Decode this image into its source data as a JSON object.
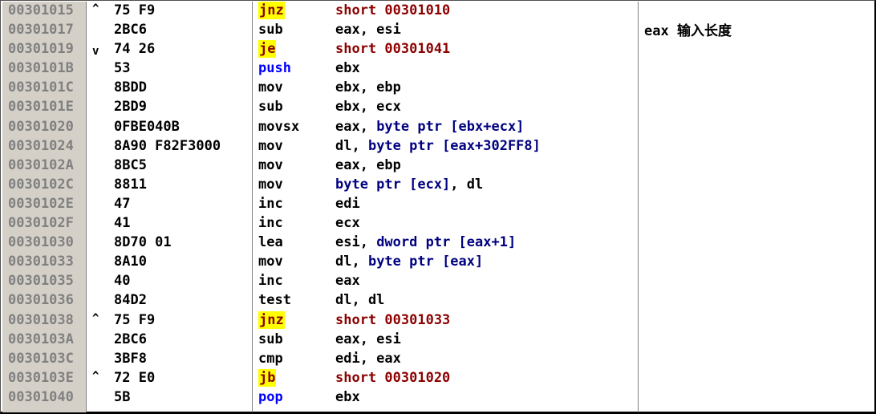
{
  "comment": "eax 输入长度",
  "rows": [
    {
      "addr": "00301015",
      "arrow": "^",
      "hex": "75 F9",
      "mnemonic": "jnz",
      "kind": "jump",
      "ops": [
        {
          "t": "short 00301010",
          "c": "jump"
        }
      ]
    },
    {
      "addr": "00301017",
      "arrow": "",
      "hex": "2BC6",
      "mnemonic": "sub",
      "kind": "plain",
      "ops": [
        {
          "t": "eax, esi",
          "c": "plain"
        }
      ]
    },
    {
      "addr": "00301019",
      "arrow": "v",
      "hex": "74 26",
      "mnemonic": "je",
      "kind": "jump",
      "ops": [
        {
          "t": "short 00301041",
          "c": "jump"
        }
      ]
    },
    {
      "addr": "0030101B",
      "arrow": "",
      "hex": "53",
      "mnemonic": "push",
      "kind": "stack",
      "ops": [
        {
          "t": "ebx",
          "c": "plain"
        }
      ]
    },
    {
      "addr": "0030101C",
      "arrow": "",
      "hex": "8BDD",
      "mnemonic": "mov",
      "kind": "plain",
      "ops": [
        {
          "t": "ebx, ebp",
          "c": "plain"
        }
      ]
    },
    {
      "addr": "0030101E",
      "arrow": "",
      "hex": "2BD9",
      "mnemonic": "sub",
      "kind": "plain",
      "ops": [
        {
          "t": "ebx, ecx",
          "c": "plain"
        }
      ]
    },
    {
      "addr": "00301020",
      "arrow": "",
      "hex": "0FBE040B",
      "mnemonic": "movsx",
      "kind": "plain",
      "ops": [
        {
          "t": "eax, ",
          "c": "plain"
        },
        {
          "t": "byte ptr [ebx+ecx]",
          "c": "size"
        }
      ]
    },
    {
      "addr": "00301024",
      "arrow": "",
      "hex": "8A90 F82F3000",
      "mnemonic": "mov",
      "kind": "plain",
      "ops": [
        {
          "t": "dl, ",
          "c": "plain"
        },
        {
          "t": "byte ptr [eax+302FF8]",
          "c": "size"
        }
      ]
    },
    {
      "addr": "0030102A",
      "arrow": "",
      "hex": "8BC5",
      "mnemonic": "mov",
      "kind": "plain",
      "ops": [
        {
          "t": "eax, ebp",
          "c": "plain"
        }
      ]
    },
    {
      "addr": "0030102C",
      "arrow": "",
      "hex": "8811",
      "mnemonic": "mov",
      "kind": "plain",
      "ops": [
        {
          "t": "byte ptr [ecx]",
          "c": "size"
        },
        {
          "t": ", dl",
          "c": "plain"
        }
      ]
    },
    {
      "addr": "0030102E",
      "arrow": "",
      "hex": "47",
      "mnemonic": "inc",
      "kind": "plain",
      "ops": [
        {
          "t": "edi",
          "c": "plain"
        }
      ]
    },
    {
      "addr": "0030102F",
      "arrow": "",
      "hex": "41",
      "mnemonic": "inc",
      "kind": "plain",
      "ops": [
        {
          "t": "ecx",
          "c": "plain"
        }
      ]
    },
    {
      "addr": "00301030",
      "arrow": "",
      "hex": "8D70 01",
      "mnemonic": "lea",
      "kind": "plain",
      "ops": [
        {
          "t": "esi, ",
          "c": "plain"
        },
        {
          "t": "dword ptr [eax+1]",
          "c": "size"
        }
      ]
    },
    {
      "addr": "00301033",
      "arrow": "",
      "hex": "8A10",
      "mnemonic": "mov",
      "kind": "plain",
      "ops": [
        {
          "t": "dl, ",
          "c": "plain"
        },
        {
          "t": "byte ptr [eax]",
          "c": "size"
        }
      ]
    },
    {
      "addr": "00301035",
      "arrow": "",
      "hex": "40",
      "mnemonic": "inc",
      "kind": "plain",
      "ops": [
        {
          "t": "eax",
          "c": "plain"
        }
      ]
    },
    {
      "addr": "00301036",
      "arrow": "",
      "hex": "84D2",
      "mnemonic": "test",
      "kind": "plain",
      "ops": [
        {
          "t": "dl, dl",
          "c": "plain"
        }
      ]
    },
    {
      "addr": "00301038",
      "arrow": "^",
      "hex": "75 F9",
      "mnemonic": "jnz",
      "kind": "jump",
      "ops": [
        {
          "t": "short 00301033",
          "c": "jump"
        }
      ]
    },
    {
      "addr": "0030103A",
      "arrow": "",
      "hex": "2BC6",
      "mnemonic": "sub",
      "kind": "plain",
      "ops": [
        {
          "t": "eax, esi",
          "c": "plain"
        }
      ]
    },
    {
      "addr": "0030103C",
      "arrow": "",
      "hex": "3BF8",
      "mnemonic": "cmp",
      "kind": "plain",
      "ops": [
        {
          "t": "edi, eax",
          "c": "plain"
        }
      ]
    },
    {
      "addr": "0030103E",
      "arrow": "^",
      "hex": "72 E0",
      "mnemonic": "jb",
      "kind": "jump",
      "ops": [
        {
          "t": "short 00301020",
          "c": "jump"
        }
      ]
    },
    {
      "addr": "00301040",
      "arrow": "",
      "hex": "5B",
      "mnemonic": "pop",
      "kind": "stack",
      "ops": [
        {
          "t": "ebx",
          "c": "plain"
        }
      ]
    }
  ]
}
